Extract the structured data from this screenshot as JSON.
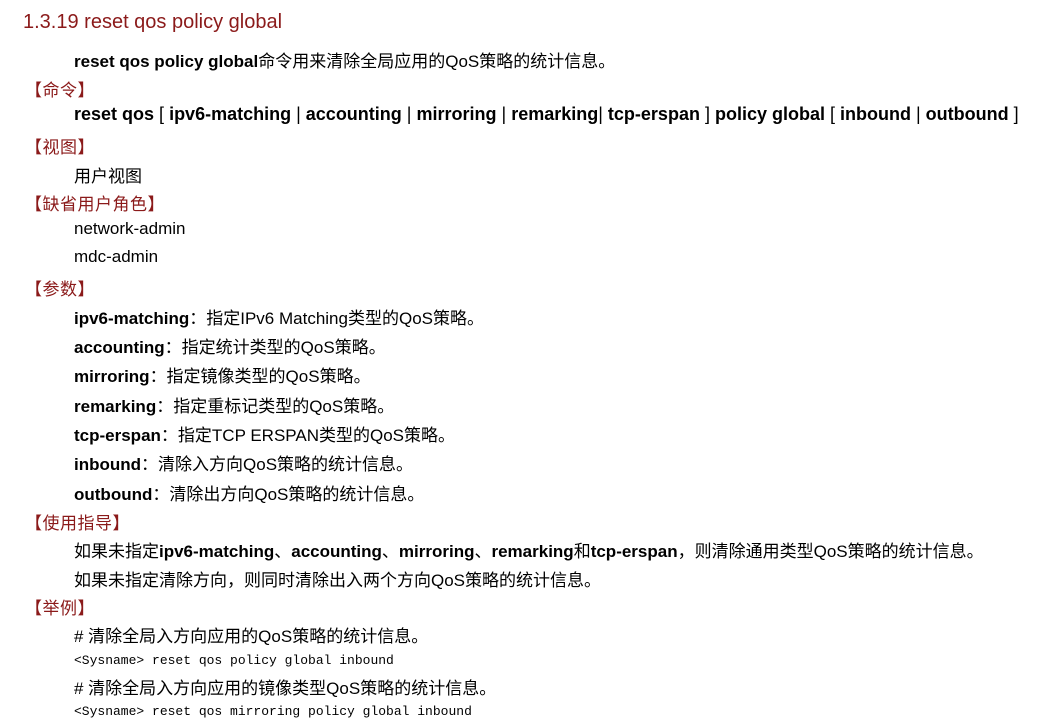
{
  "title": "1.3.19  reset qos policy global",
  "intro": {
    "cmd": "reset qos policy global",
    "desc": "命令用来清除全局应用的QoS策略的统计信息。"
  },
  "sections": {
    "command": "【命令】",
    "view": "【视图】",
    "role": "【缺省用户角色】",
    "params": "【参数】",
    "guide": "【使用指导】",
    "example": "【举例】"
  },
  "syntax": {
    "t1": "reset qos",
    "t2": " [ ",
    "t3": "ipv6-matching",
    "t4": " | ",
    "t5": "accounting",
    "t6": " | ",
    "t7": "mirroring",
    "t8": " | ",
    "t9": "remarking",
    "t10": "| ",
    "t11": "tcp-erspan",
    "t12": " ] ",
    "t13": "policy global",
    "t14": " [ ",
    "t15": "inbound",
    "t16": " | ",
    "t17": "outbound",
    "t18": " ]"
  },
  "view_text": "用户视图",
  "roles": [
    "network-admin",
    "mdc-admin"
  ],
  "params": [
    {
      "name": "ipv6-matching",
      "desc": "：指定IPv6 Matching类型的QoS策略。"
    },
    {
      "name": "accounting",
      "desc": "：指定统计类型的QoS策略。"
    },
    {
      "name": "mirroring",
      "desc": "：指定镜像类型的QoS策略。"
    },
    {
      "name": "remarking",
      "desc": "：指定重标记类型的QoS策略。"
    },
    {
      "name": "tcp-erspan",
      "desc": "：指定TCP ERSPAN类型的QoS策略。"
    },
    {
      "name": "inbound",
      "desc": "：清除入方向QoS策略的统计信息。"
    },
    {
      "name": "outbound",
      "desc": "：清除出方向QoS策略的统计信息。"
    }
  ],
  "guide": {
    "l1": {
      "a": "如果未指定",
      "b": "ipv6-matching",
      "c": "、",
      "d": "accounting",
      "e": "、",
      "f": "mirroring",
      "g": "、",
      "h": "remarking",
      "i": "和",
      "j": "tcp-erspan",
      "k": "，则清除通用类型QoS策略的统计信息。"
    },
    "l2": "如果未指定清除方向，则同时清除出入两个方向QoS策略的统计信息。"
  },
  "examples": [
    {
      "comment": "# 清除全局入方向应用的QoS策略的统计信息。",
      "code": "<Sysname> reset qos policy global inbound"
    },
    {
      "comment": "# 清除全局入方向应用的镜像类型QoS策略的统计信息。",
      "code": "<Sysname> reset qos mirroring policy global inbound"
    }
  ]
}
